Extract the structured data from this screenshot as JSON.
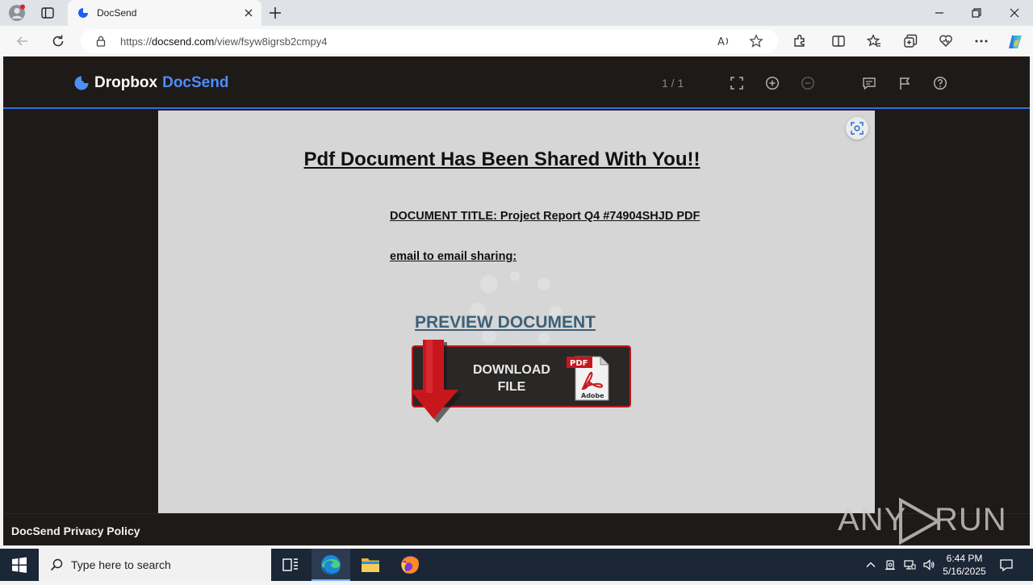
{
  "browser": {
    "tab_title": "DocSend",
    "url_scheme": "https://",
    "url_host": "docsend.com",
    "url_path": "/view/fsyw8igrsb2cmpy4"
  },
  "docsend": {
    "logo_primary": "Dropbox",
    "logo_secondary": "DocSend",
    "page_counter": "1 / 1",
    "brand_color": "#4f8dfb",
    "accent_line_color": "#2f6fe0"
  },
  "document": {
    "heading": "Pdf Document Has Been Shared With You!!",
    "title_line": "DOCUMENT TITLE:  Project Report Q4 #74904SHJD  PDF",
    "email_line": "email to email sharing:",
    "preview_link": "PREVIEW DOCUMENT",
    "download_line1": "DOWNLOAD",
    "download_line2": "FILE",
    "pdf_badge": "PDF",
    "pdf_brand": "Adobe"
  },
  "footer": {
    "privacy_link": "DocSend Privacy Policy"
  },
  "watermark": {
    "left": "ANY",
    "right": "RUN"
  },
  "taskbar": {
    "search_placeholder": "Type here to search",
    "time": "6:44 PM",
    "date": "5/16/2025"
  }
}
